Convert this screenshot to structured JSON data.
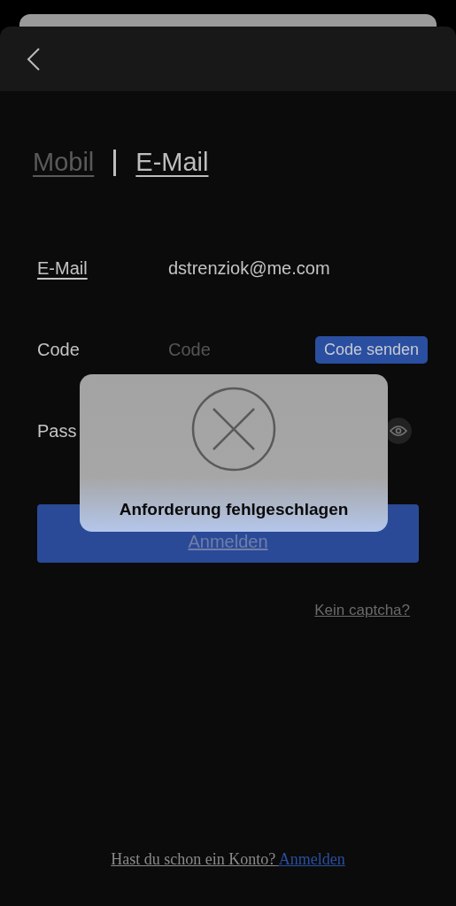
{
  "tabs": [
    {
      "label": "Mobil",
      "selected": false
    },
    {
      "label": "E-Mail",
      "selected": true
    }
  ],
  "fields": [
    {
      "kind": "text",
      "label": "E-Mail",
      "value": "dstrenziok@me.com"
    },
    {
      "kind": "code",
      "label": "Code",
      "placeholder": "Code",
      "action": "Code senden"
    },
    {
      "kind": "password",
      "label": "Pass"
    }
  ],
  "submit": "Anmelden",
  "no_captcha": "Kein captcha?",
  "footer": {
    "text": "Hast du schon ein Konto?",
    "link": "Anmelden"
  },
  "toast": {
    "message": "Anforderung fehlgeschlagen"
  }
}
